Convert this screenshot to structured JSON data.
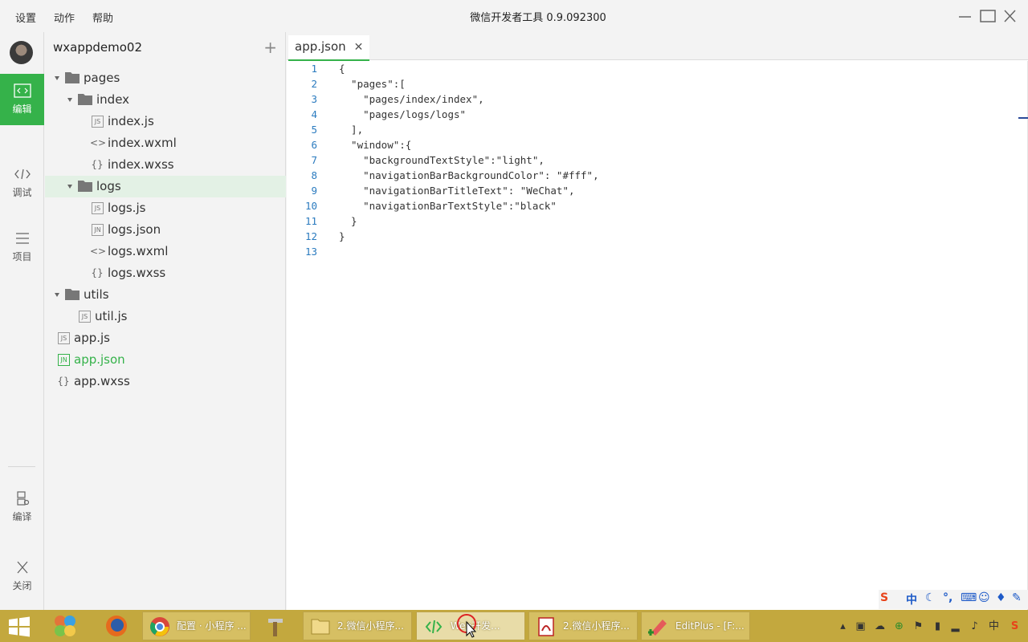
{
  "menu": [
    "设置",
    "动作",
    "帮助"
  ],
  "window_title": "微信开发者工具 0.9.092300",
  "sidebar": {
    "nav": [
      {
        "label": "编辑",
        "icon": "code-edit-icon",
        "active": true
      },
      {
        "label": "调试",
        "icon": "debug-icon",
        "active": false
      },
      {
        "label": "项目",
        "icon": "project-icon",
        "active": false
      },
      {
        "label": "编译",
        "icon": "compile-icon",
        "active": false
      },
      {
        "label": "关闭",
        "icon": "close-icon",
        "active": false
      }
    ],
    "accent": "#35b24a"
  },
  "project": {
    "name": "wxappdemo02",
    "tree": [
      {
        "label": "pages",
        "type": "folder"
      },
      {
        "label": "index",
        "type": "folder"
      },
      {
        "label": "index.js",
        "type": "JS"
      },
      {
        "label": "index.wxml",
        "type": "<>"
      },
      {
        "label": "index.wxss",
        "type": "{}"
      },
      {
        "label": "logs",
        "type": "folder"
      },
      {
        "label": "logs.js",
        "type": "JS"
      },
      {
        "label": "logs.json",
        "type": "JN"
      },
      {
        "label": "logs.wxml",
        "type": "<>"
      },
      {
        "label": "logs.wxss",
        "type": "{}"
      },
      {
        "label": "utils",
        "type": "folder"
      },
      {
        "label": "util.js",
        "type": "JS"
      },
      {
        "label": "app.js",
        "type": "JS"
      },
      {
        "label": "app.json",
        "type": "JN"
      },
      {
        "label": "app.wxss",
        "type": "{}"
      }
    ]
  },
  "editor": {
    "tab": "app.json",
    "lines": [
      {
        "n": "1",
        "text": "{"
      },
      {
        "n": "2",
        "text": "  \"pages\":["
      },
      {
        "n": "3",
        "text": "    \"pages/index/index\","
      },
      {
        "n": "4",
        "text": "    \"pages/logs/logs\""
      },
      {
        "n": "5",
        "text": "  ],"
      },
      {
        "n": "6",
        "text": "  \"window\":{"
      },
      {
        "n": "7",
        "text": "    \"backgroundTextStyle\":\"light\","
      },
      {
        "n": "8",
        "text": "    \"navigationBarBackgroundColor\": \"#fff\","
      },
      {
        "n": "9",
        "text": "    \"navigationBarTitleText\": \"WeChat\","
      },
      {
        "n": "10",
        "text": "    \"navigationBarTextStyle\":\"black\""
      },
      {
        "n": "11",
        "text": "  }"
      },
      {
        "n": "12",
        "text": "}"
      },
      {
        "n": "13",
        "text": ""
      }
    ]
  },
  "taskbar": {
    "buttons": [
      {
        "label": "配置 · 小程序 ...",
        "icon": "chrome-icon"
      },
      {
        "label": "2.微信小程序...",
        "icon": "folder-icon"
      },
      {
        "label": "Web开发...",
        "icon": "wechat-devtools-icon"
      },
      {
        "label": "2.微信小程序...",
        "icon": "pdf-icon"
      },
      {
        "label": "EditPlus - [F:...",
        "icon": "editplus-icon"
      }
    ],
    "tray_text": "中",
    "color": "#c3a83e"
  },
  "ime": {
    "label": "中"
  }
}
